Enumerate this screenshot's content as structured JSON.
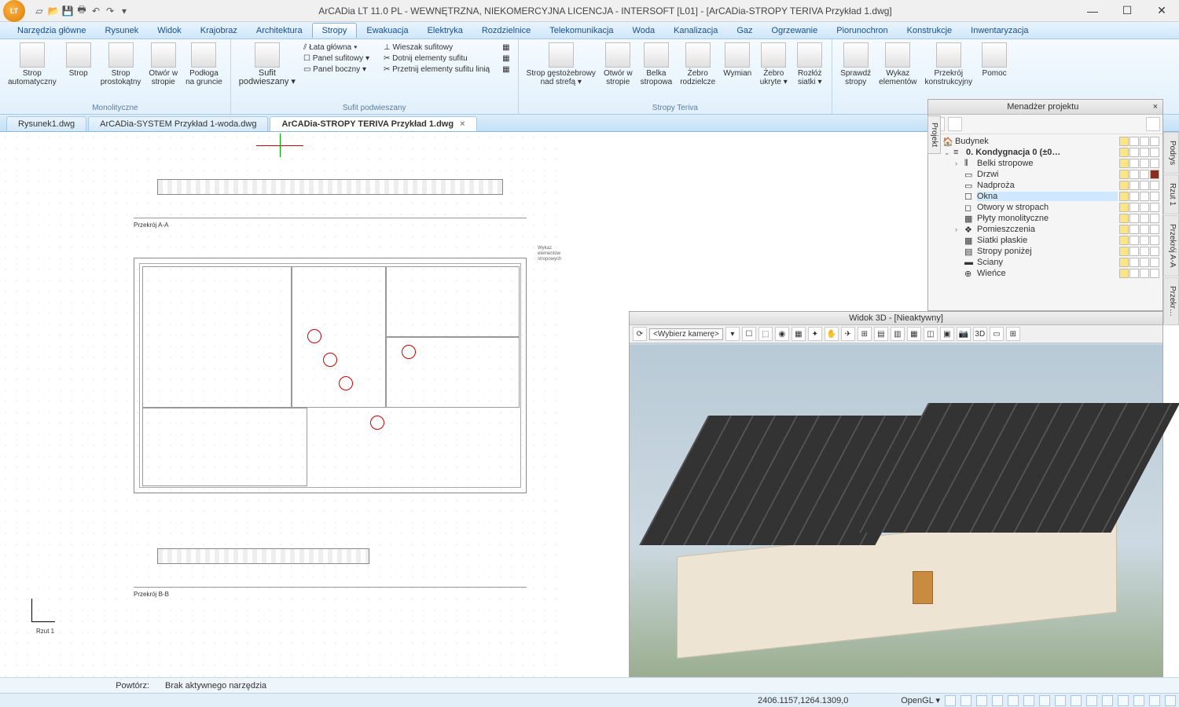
{
  "title": "ArCADia LT 11.0 PL - WEWNĘTRZNA, NIEKOMERCYJNA LICENCJA - INTERSOFT [L01] - [ArCADia-STROPY TERIVA Przykład 1.dwg]",
  "app_badge": "LT",
  "menu": [
    "Narzędzia główne",
    "Rysunek",
    "Widok",
    "Krajobraz",
    "Architektura",
    "Stropy",
    "Ewakuacja",
    "Elektryka",
    "Rozdzielnice",
    "Telekomunikacja",
    "Woda",
    "Kanalizacja",
    "Gaz",
    "Ogrzewanie",
    "Piorunochron",
    "Konstrukcje",
    "Inwentaryzacja"
  ],
  "menu_active": "Stropy",
  "ribbon": {
    "g1": {
      "label": "Monolityczne",
      "btns": [
        {
          "l1": "Strop",
          "l2": "automatyczny"
        },
        {
          "l1": "Strop",
          "l2": ""
        },
        {
          "l1": "Strop",
          "l2": "prostokątny"
        },
        {
          "l1": "Otwór w",
          "l2": "stropie"
        },
        {
          "l1": "Podłoga",
          "l2": "na gruncie"
        }
      ]
    },
    "g2": {
      "label": "Sufit podwieszany",
      "btn": {
        "l1": "Sufit",
        "l2": "podwieszany ▾"
      },
      "rows": [
        "⫽ Łata główna ▾",
        "☐ Panel sufitowy ▾",
        "▭ Panel boczny ▾"
      ],
      "rows2": [
        "⊥ Wieszak sufitowy",
        "✂ Dotnij elementy sufitu",
        "✂ Przetnij elementy sufitu linią"
      ]
    },
    "g3": {
      "label": "Stropy Teriva",
      "btns": [
        {
          "l1": "Strop gęstożebrowy",
          "l2": "nad strefą ▾"
        },
        {
          "l1": "Otwór w",
          "l2": "stropie"
        },
        {
          "l1": "Belka",
          "l2": "stropowa"
        },
        {
          "l1": "Żebro",
          "l2": "rodzielcze"
        },
        {
          "l1": "Wymian",
          "l2": ""
        },
        {
          "l1": "Żebro",
          "l2": "ukryte ▾"
        },
        {
          "l1": "Rozłóż",
          "l2": "siatki ▾"
        }
      ]
    },
    "g4": {
      "btns": [
        {
          "l1": "Sprawdź",
          "l2": "stropy"
        },
        {
          "l1": "Wykaz",
          "l2": "elementów"
        },
        {
          "l1": "Przekrój",
          "l2": "konstrukcyjny"
        },
        {
          "l1": "Pomoc",
          "l2": ""
        }
      ]
    }
  },
  "tabs": [
    {
      "label": "Rysunek1.dwg",
      "active": false
    },
    {
      "label": "ArCADia-SYSTEM Przykład 1-woda.dwg",
      "active": false
    },
    {
      "label": "ArCADia-STROPY TERIVA Przykład 1.dwg",
      "active": true
    }
  ],
  "pm": {
    "title": "Menadżer projektu",
    "tree": [
      {
        "ind": 0,
        "tw": "⌄",
        "txt": "Budynek",
        "ico": "🏠"
      },
      {
        "ind": 1,
        "tw": "⌄",
        "txt": "0. Kondygnacja 0 (±0…",
        "ico": "≡",
        "bold": true
      },
      {
        "ind": 2,
        "tw": "›",
        "txt": "Belki stropowe",
        "ico": "⫴"
      },
      {
        "ind": 2,
        "tw": "",
        "txt": "Drzwi",
        "ico": "▭",
        "sw": "#8b2e1e"
      },
      {
        "ind": 2,
        "tw": "",
        "txt": "Nadproża",
        "ico": "▭"
      },
      {
        "ind": 2,
        "tw": "",
        "txt": "Okna",
        "ico": "☐",
        "sel": true
      },
      {
        "ind": 2,
        "tw": "",
        "txt": "Otwory w stropach",
        "ico": "◻"
      },
      {
        "ind": 2,
        "tw": "",
        "txt": "Płyty monolityczne",
        "ico": "▦"
      },
      {
        "ind": 2,
        "tw": "›",
        "txt": "Pomieszczenia",
        "ico": "❖"
      },
      {
        "ind": 2,
        "tw": "",
        "txt": "Siatki płaskie",
        "ico": "▦"
      },
      {
        "ind": 2,
        "tw": "",
        "txt": "Stropy poniżej",
        "ico": "▤"
      },
      {
        "ind": 2,
        "tw": "",
        "txt": "Ściany",
        "ico": "▬"
      },
      {
        "ind": 2,
        "tw": "",
        "txt": "Wieńce",
        "ico": "⊕"
      }
    ]
  },
  "side_tabs": [
    "Podrys",
    "Rzut 1",
    "Przekrój A-A",
    "Przekr…"
  ],
  "proj_tab": "Projekt",
  "v3d": {
    "title": "Widok 3D - [Nieaktywny]",
    "cam": "<Wybierz kamerę>"
  },
  "status": {
    "label": "Powtórz:",
    "tool": "Brak aktywnego narzędzia"
  },
  "bottom": {
    "coords": "2406.1157,1264.1309,0",
    "render": "OpenGL ▾"
  },
  "sect_a": "Przekrój A-A",
  "sect_b": "Przekrój B-B",
  "axis_lbl": "Rzut 1"
}
